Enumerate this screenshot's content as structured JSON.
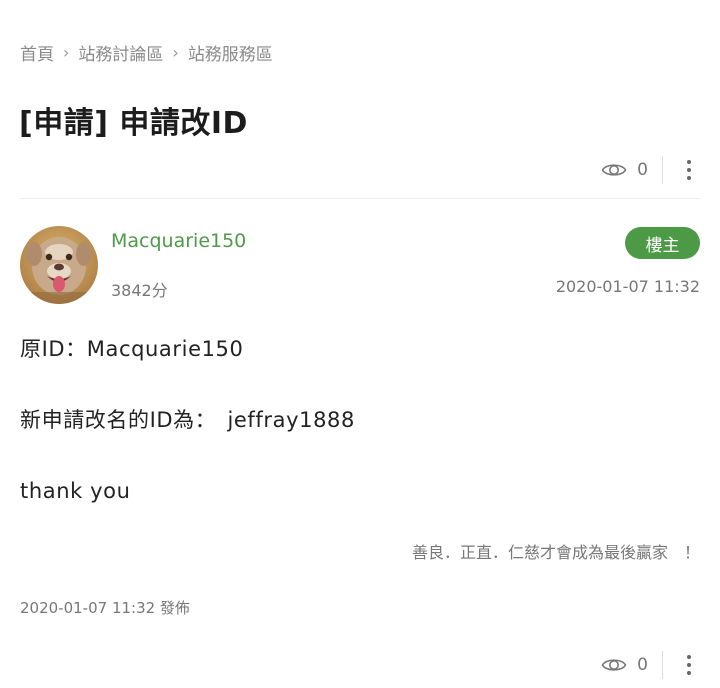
{
  "breadcrumb": {
    "items": [
      "首頁",
      "站務討論區",
      "站務服務區"
    ]
  },
  "thread": {
    "title": "[申請] 申請改ID",
    "views": "0"
  },
  "post": {
    "author": "Macquarie150",
    "score": "3842分",
    "badge": "樓主",
    "time": "2020-01-07 11:32",
    "body": [
      "原ID：Macquarie150",
      "新申請改名的ID為：　jeffray1888",
      "thank you"
    ],
    "signature": "善良．正直．仁慈才會成為最後贏家　！",
    "posted_at": "2020-01-07 11:32 發佈",
    "views": "0"
  },
  "colors": {
    "accent_green": "#4c9a45",
    "author_green": "#4f9a4a",
    "muted_text": "#777777"
  },
  "icons": {
    "breadcrumb_separator": "chevron-right-icon",
    "views": "eye-icon",
    "more": "more-vertical-icon"
  }
}
